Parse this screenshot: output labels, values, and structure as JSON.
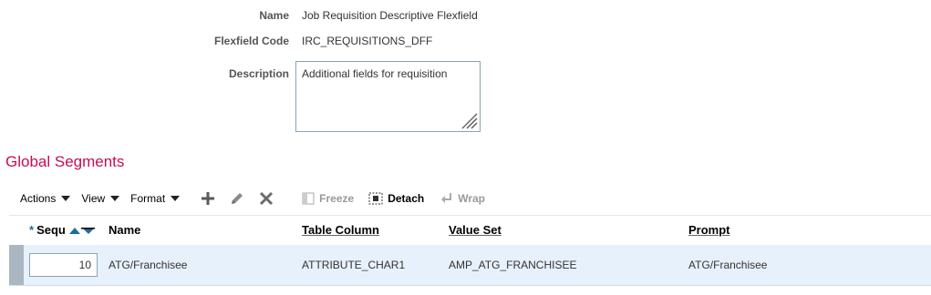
{
  "form": {
    "name_label": "Name",
    "name_value": "Job Requisition Descriptive Flexfield",
    "code_label": "Flexfield Code",
    "code_value": "IRC_REQUISITIONS_DFF",
    "description_label": "Description",
    "description_value": "Additional fields for requisition"
  },
  "section": {
    "title": "Global Segments"
  },
  "toolbar": {
    "actions": "Actions",
    "view": "View",
    "format": "Format",
    "add_icon": "plus-icon",
    "edit_icon": "pencil-icon",
    "delete_icon": "x-icon",
    "freeze": "Freeze",
    "detach": "Detach",
    "wrap": "Wrap"
  },
  "table": {
    "required_marker": "*",
    "columns": [
      "Sequence",
      "Name",
      "Table Column",
      "Value Set",
      "Prompt"
    ],
    "seq_header_visible": "Sequ",
    "rows": [
      {
        "sequence": "10",
        "name": "ATG/Franchisee",
        "table_column": "ATTRIBUTE_CHAR1",
        "value_set": "AMP_ATG_FRANCHISEE",
        "prompt": "ATG/Franchisee"
      }
    ]
  },
  "colors": {
    "section_title": "#c60c55",
    "row_selected_bg": "#e7f1fb",
    "accent": "#1c6d9e"
  }
}
